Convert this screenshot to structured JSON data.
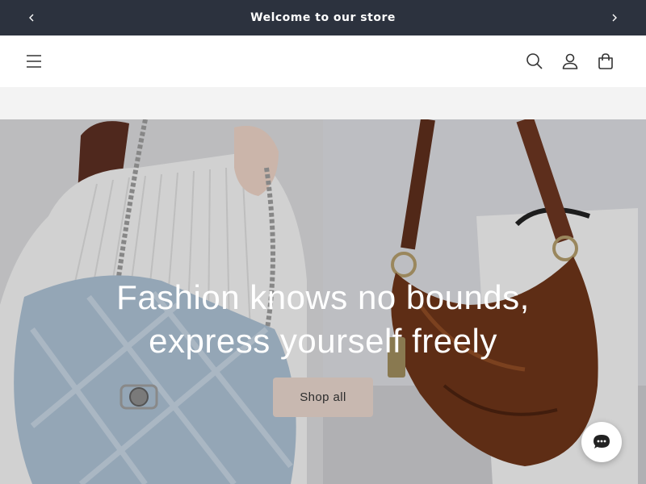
{
  "announcement": {
    "text": "Welcome to our store",
    "prev_icon": "chevron-left-icon",
    "next_icon": "chevron-right-icon"
  },
  "header": {
    "menu_icon": "hamburger-menu-icon",
    "search_icon": "search-icon",
    "account_icon": "account-icon",
    "cart_icon": "shopping-bag-icon"
  },
  "hero": {
    "heading_line1": "Fashion knows no bounds,",
    "heading_line2": "express yourself freely",
    "button_label": "Shop all",
    "left_image": "model-with-denim-quilted-bag",
    "right_image": "brown-leather-hobo-bag"
  },
  "chat": {
    "icon": "chat-bubble-icon"
  },
  "colors": {
    "announcement_bg": "#2c323e",
    "strip_bg": "#f3f3f3",
    "button_bg": "#c8b8b0"
  }
}
